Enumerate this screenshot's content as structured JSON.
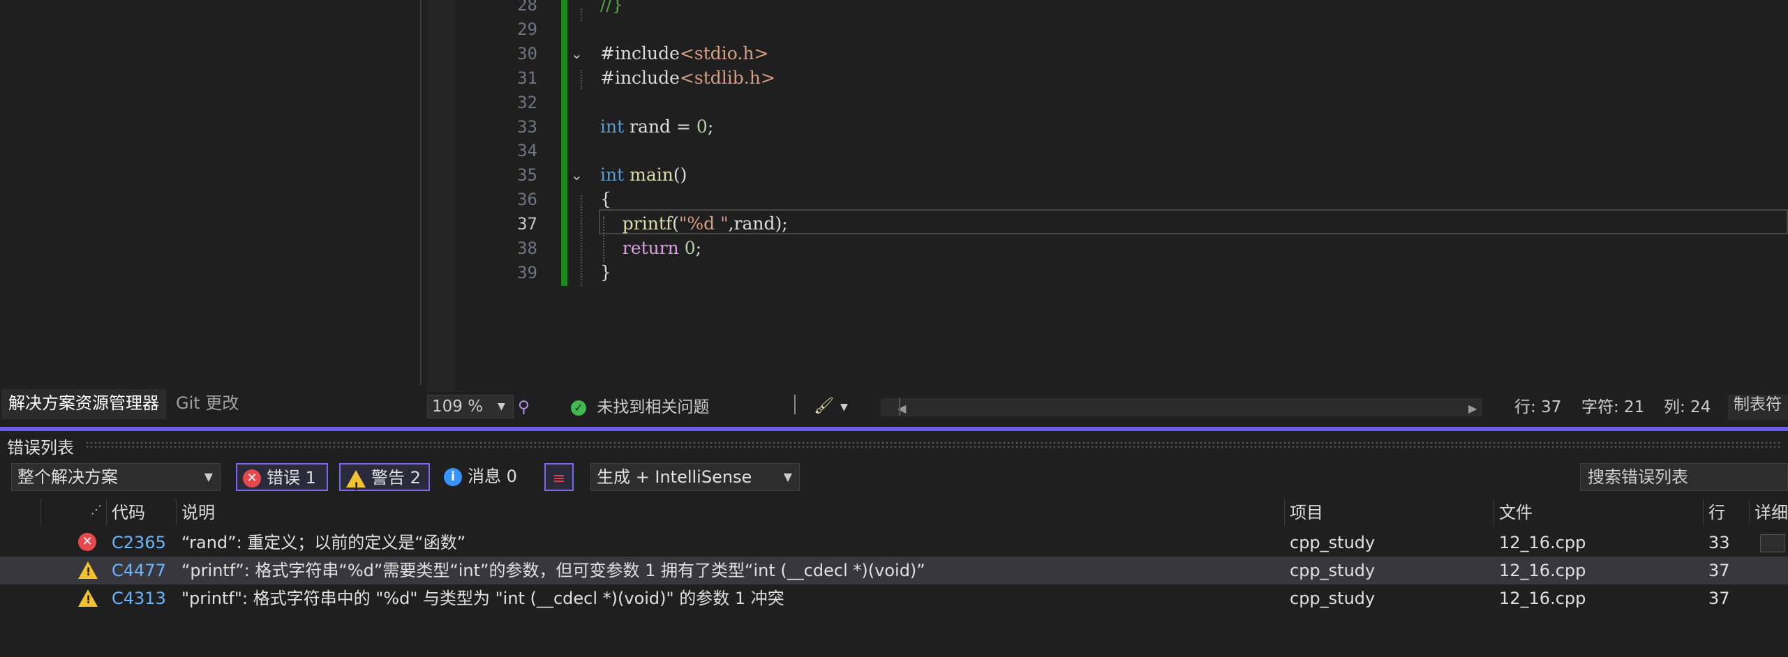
{
  "solution_explorer": {
    "tabs": [
      "解决方案资源管理器",
      "Git 更改"
    ]
  },
  "editor": {
    "lines": [
      {
        "num": "28",
        "fold": "",
        "tokens": [
          {
            "t": "//}",
            "c": "cmt"
          }
        ]
      },
      {
        "num": "29",
        "fold": "",
        "tokens": []
      },
      {
        "num": "30",
        "fold": "v",
        "tokens": [
          {
            "t": "#include",
            "c": "var"
          },
          {
            "t": "<stdio.h>",
            "c": "str"
          }
        ]
      },
      {
        "num": "31",
        "fold": "",
        "tokens": [
          {
            "t": "#include",
            "c": "var"
          },
          {
            "t": "<stdlib.h>",
            "c": "str"
          }
        ]
      },
      {
        "num": "32",
        "fold": "",
        "tokens": []
      },
      {
        "num": "33",
        "fold": "",
        "tokens": [
          {
            "t": "int",
            "c": "kw"
          },
          {
            "t": " rand = ",
            "c": "var"
          },
          {
            "t": "0",
            "c": "num"
          },
          {
            "t": ";",
            "c": "var"
          }
        ]
      },
      {
        "num": "34",
        "fold": "",
        "tokens": []
      },
      {
        "num": "35",
        "fold": "v",
        "tokens": [
          {
            "t": "int",
            "c": "kw"
          },
          {
            "t": " ",
            "c": "var"
          },
          {
            "t": "main",
            "c": "fn"
          },
          {
            "t": "()",
            "c": "var"
          }
        ]
      },
      {
        "num": "36",
        "fold": "",
        "tokens": [
          {
            "t": "{",
            "c": "var"
          }
        ]
      },
      {
        "num": "37",
        "fold": "",
        "tokens": [
          {
            "t": "    ",
            "c": "var"
          },
          {
            "t": "printf",
            "c": "fn"
          },
          {
            "t": "(",
            "c": "var"
          },
          {
            "t": "\"%d \"",
            "c": "str"
          },
          {
            "t": ",rand);",
            "c": "var"
          }
        ]
      },
      {
        "num": "38",
        "fold": "",
        "tokens": [
          {
            "t": "    ",
            "c": "var"
          },
          {
            "t": "return",
            "c": "ctl"
          },
          {
            "t": " ",
            "c": "var"
          },
          {
            "t": "0",
            "c": "num"
          },
          {
            "t": ";",
            "c": "var"
          }
        ]
      },
      {
        "num": "39",
        "fold": "",
        "tokens": [
          {
            "t": "}",
            "c": "var"
          }
        ]
      }
    ],
    "current_line": "37"
  },
  "editor_status": {
    "zoom": "109 %",
    "issues": "未找到相关问题",
    "row": "行: 37",
    "char": "字符: 21",
    "col": "列: 24",
    "tab": "制表符"
  },
  "error_list": {
    "title": "错误列表",
    "scope": "整个解决方案",
    "errors_btn": "错误 1",
    "warnings_btn": "警告 2",
    "messages_btn": "消息 0",
    "source": "生成 + IntelliSense",
    "search_placeholder": "搜索错误列表",
    "columns": {
      "code": "代码",
      "desc": "说明",
      "project": "项目",
      "file": "文件",
      "line": "行",
      "detail": "详细"
    },
    "rows": [
      {
        "severity": "error",
        "code": "C2365",
        "desc": "“rand”: 重定义；以前的定义是“函数”",
        "project": "cpp_study",
        "file": "12_16.cpp",
        "line": "33"
      },
      {
        "severity": "warning",
        "code": "C4477",
        "desc": "“printf”: 格式字符串“%d”需要类型“int”的参数，但可变参数 1 拥有了类型“int (__cdecl *)(void)”",
        "project": "cpp_study",
        "file": "12_16.cpp",
        "line": "37"
      },
      {
        "severity": "warning",
        "code": "C4313",
        "desc": "\"printf\": 格式字符串中的 \"%d\" 与类型为 \"int (__cdecl *)(void)\" 的参数 1 冲突",
        "project": "cpp_study",
        "file": "12_16.cpp",
        "line": "37"
      }
    ]
  },
  "colors": {
    "accent": "#6c5ce7",
    "change_bar": "#1a8a1a",
    "error": "#e5484d",
    "warning": "#f1c232",
    "info": "#3794ff"
  }
}
